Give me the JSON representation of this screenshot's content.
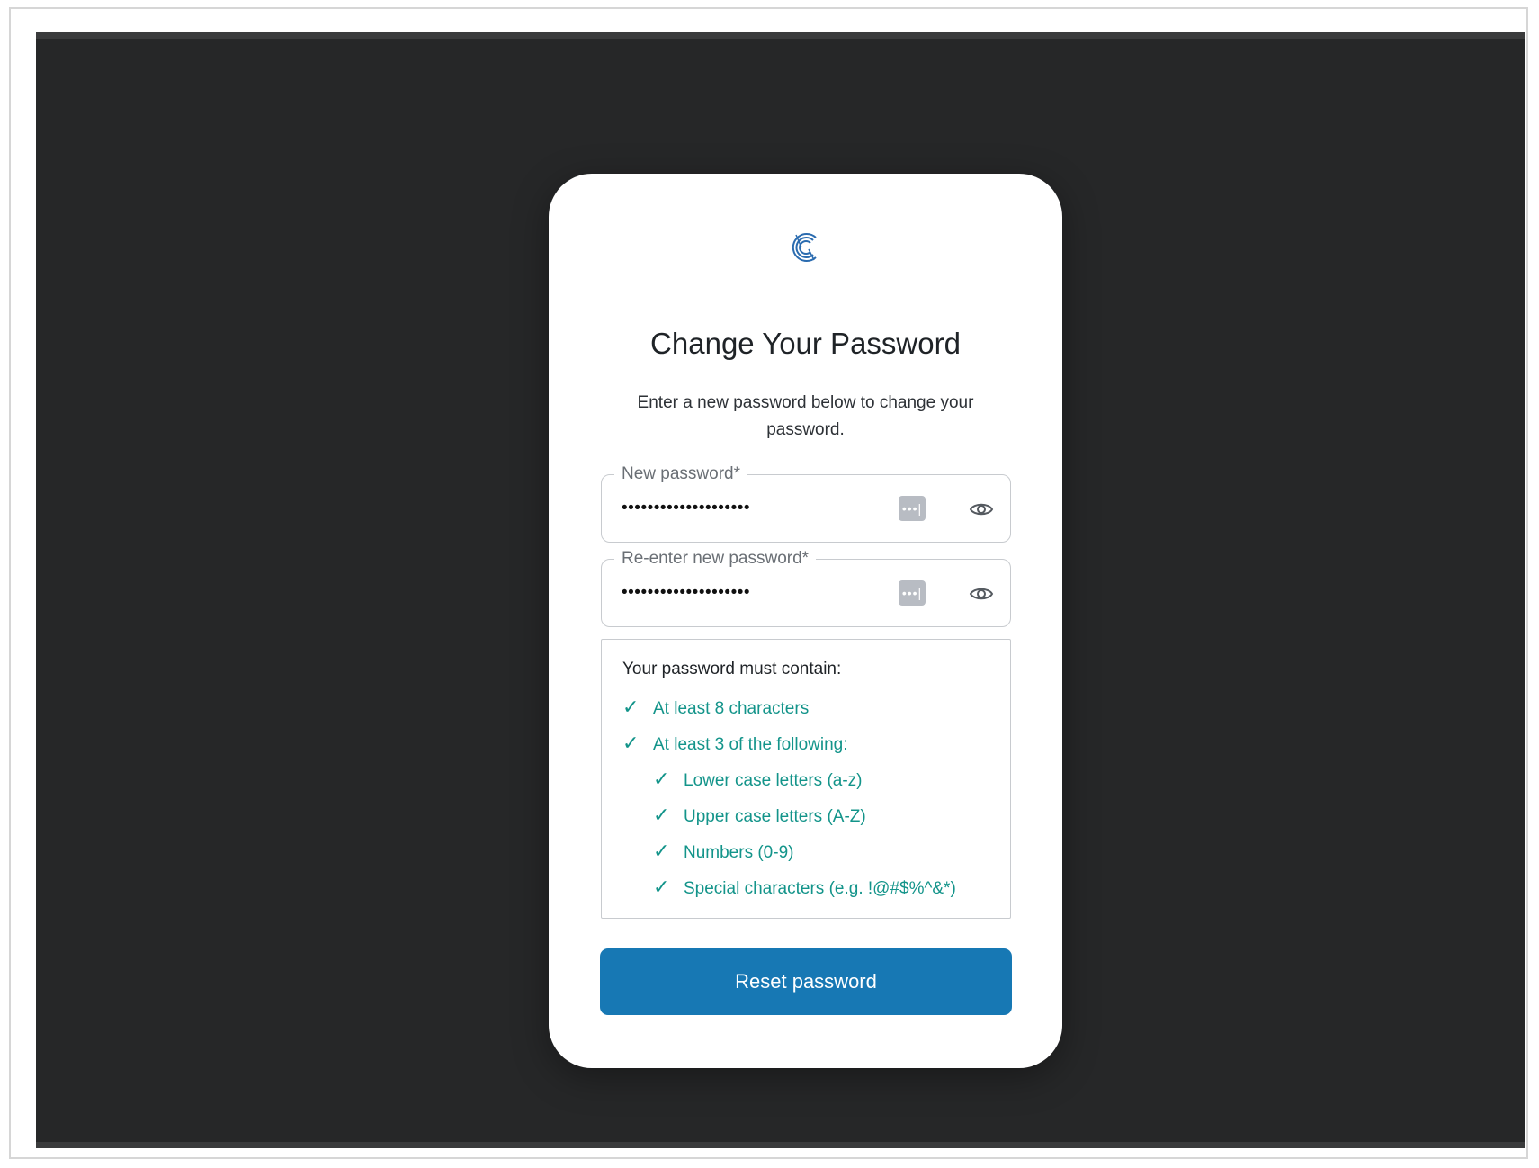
{
  "colors": {
    "background": "#262728",
    "card": "#ffffff",
    "accent": "#1778b4",
    "success": "#13948a",
    "logo": "#2b6cb0"
  },
  "logo": {
    "icon": "stylized-c-logo-icon"
  },
  "header": {
    "title": "Change Your Password",
    "subtitle": "Enter a new password below to change your password."
  },
  "form": {
    "new_password": {
      "label": "New password*",
      "value": "••••••••••••••••••••",
      "pw_manager_icon": "•••|",
      "toggle_icon": "eye-icon"
    },
    "confirm_password": {
      "label": "Re-enter new password*",
      "value": "••••••••••••••••••••",
      "pw_manager_icon": "•••|",
      "toggle_icon": "eye-icon"
    }
  },
  "requirements": {
    "heading": "Your password must contain:",
    "check_symbol": "✓",
    "items": [
      {
        "text": "At least 8 characters",
        "met": true
      },
      {
        "text": "At least 3 of the following:",
        "met": true
      },
      {
        "text": "Lower case letters (a-z)",
        "met": true
      },
      {
        "text": "Upper case letters (A-Z)",
        "met": true
      },
      {
        "text": "Numbers (0-9)",
        "met": true
      },
      {
        "text": "Special characters (e.g. !@#$%^&*)",
        "met": true
      }
    ]
  },
  "submit": {
    "label": "Reset password"
  }
}
